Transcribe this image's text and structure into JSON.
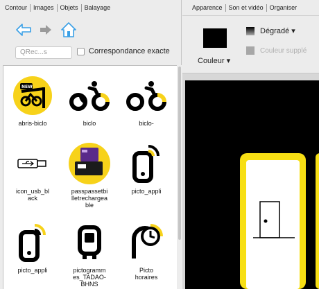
{
  "left_tabs": [
    "Contour",
    "Images",
    "Objets",
    "Balayage"
  ],
  "right_tabs": [
    "Apparence",
    "Son et vidéo",
    "Organiser"
  ],
  "search": {
    "placeholder": "QRec...s"
  },
  "exact_match_label": "Correspondance exacte",
  "items": [
    {
      "label": "abris-biclo",
      "icon": "abris-biclo-icon"
    },
    {
      "label": "biclo",
      "icon": "bike-icon"
    },
    {
      "label": "biclo-",
      "icon": "bike-icon"
    },
    {
      "label": "icon_usb_bl\nack",
      "icon": "usb-icon"
    },
    {
      "label": "passpassetbi\nlletrechargea\nble",
      "icon": "ticket-icon"
    },
    {
      "label": "picto_appli",
      "icon": "phone-signal-icon"
    },
    {
      "label": "picto_appli",
      "icon": "phone-signal-icon"
    },
    {
      "label": "pictogramm\nes_TADAO-\nBHNS",
      "icon": "bus-icon"
    },
    {
      "label": "Picto\nhoraires",
      "icon": "clock-icon"
    }
  ],
  "toolbar": {
    "color_label": "Couleur ▾",
    "gradient_label": "Dégradé ▾",
    "extra_color_label": "Couleur supplé",
    "fill_color": "#000000"
  },
  "colors": {
    "accent": "#f7df14",
    "ui_bg": "#ececec",
    "link_blue": "#3aa0e6"
  }
}
